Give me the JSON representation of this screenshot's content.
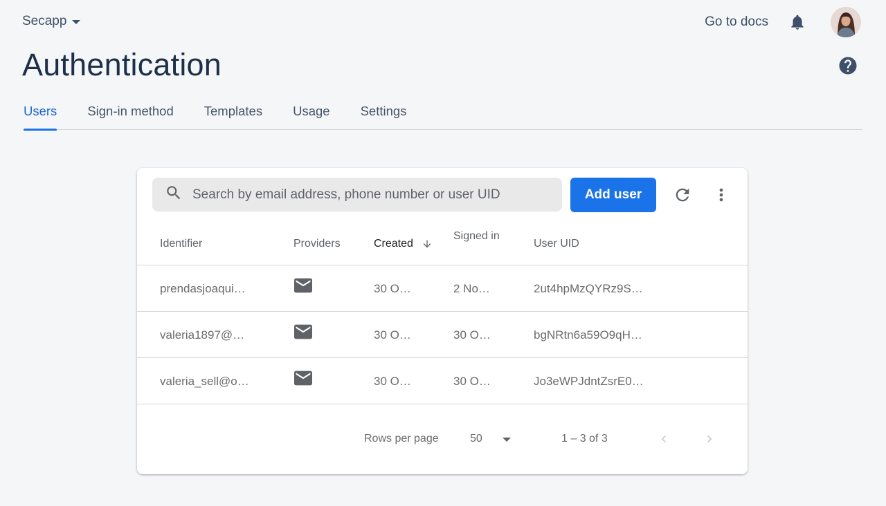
{
  "header": {
    "project_name": "Secapp",
    "docs_link": "Go to docs",
    "page_title": "Authentication"
  },
  "tabs": [
    {
      "label": "Users",
      "active": true
    },
    {
      "label": "Sign-in method",
      "active": false
    },
    {
      "label": "Templates",
      "active": false
    },
    {
      "label": "Usage",
      "active": false
    },
    {
      "label": "Settings",
      "active": false
    }
  ],
  "toolbar": {
    "search_placeholder": "Search by email address, phone number or user UID",
    "add_user_label": "Add user"
  },
  "table": {
    "columns": [
      "Identifier",
      "Providers",
      "Created",
      "Signed in",
      "User UID"
    ],
    "sorted_column": "Created",
    "rows": [
      {
        "identifier": "prendasjoaqui…",
        "provider": "email-icon",
        "created": "30 O…",
        "signed_in": "2 No…",
        "uid": "2ut4hpMzQYRz9S…"
      },
      {
        "identifier": "valeria1897@…",
        "provider": "email-icon",
        "created": "30 O…",
        "signed_in": "30 O…",
        "uid": "bgNRtn6a59O9qH…"
      },
      {
        "identifier": "valeria_sell@o…",
        "provider": "email-icon",
        "created": "30 O…",
        "signed_in": "30 O…",
        "uid": "Jo3eWPJdntZsrE0…"
      }
    ]
  },
  "pagination": {
    "rows_per_page_label": "Rows per page",
    "rows_per_page_value": "50",
    "range": "1 – 3 of 3"
  },
  "colors": {
    "accent": "#1a73e8",
    "title": "#1e3048",
    "background": "#f5f6f8"
  }
}
